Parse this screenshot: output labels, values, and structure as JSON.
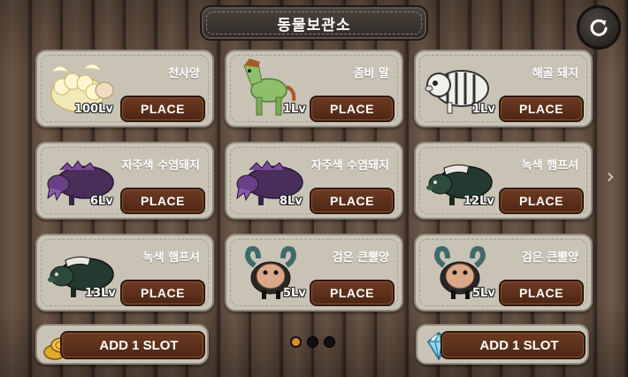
{
  "header": {
    "title": "동물보관소"
  },
  "icons": {
    "refresh": "refresh-icon",
    "next": "chevron-right-icon"
  },
  "cards": [
    {
      "name": "천사양",
      "level": "100Lv",
      "button": "PLACE",
      "animal": "angel-sheep-icon"
    },
    {
      "name": "좀비 말",
      "level": "1Lv",
      "button": "PLACE",
      "animal": "zombie-horse-icon"
    },
    {
      "name": "해골 돼지",
      "level": "1Lv",
      "button": "PLACE",
      "animal": "skeleton-pig-icon"
    },
    {
      "name": "자주색 수염돼지",
      "level": "6Lv",
      "button": "PLACE",
      "animal": "purple-bearded-pig-icon"
    },
    {
      "name": "자주색 수염돼지",
      "level": "8Lv",
      "button": "PLACE",
      "animal": "purple-bearded-pig-icon"
    },
    {
      "name": "녹색 햄프셔",
      "level": "12Lv",
      "button": "PLACE",
      "animal": "green-hampshire-icon"
    },
    {
      "name": "녹색 햄프셔",
      "level": "13Lv",
      "button": "PLACE",
      "animal": "green-hampshire-icon"
    },
    {
      "name": "검은 큰뿔양",
      "level": "5Lv",
      "button": "PLACE",
      "animal": "black-bighorn-sheep-icon"
    },
    {
      "name": "검은 큰뿔양",
      "level": "5Lv",
      "button": "PLACE",
      "animal": "black-bighorn-sheep-icon"
    }
  ],
  "footer": {
    "left_slot": {
      "label": "ADD 1 SLOT",
      "icon": "gold-coins-icon"
    },
    "right_slot": {
      "label": "ADD 1 SLOT",
      "icon": "crystal-gem-icon"
    },
    "pager": {
      "pages": 3,
      "current": 1
    }
  },
  "colors": {
    "accent": "#e08a2a",
    "button": "#5a2e18",
    "card": "#c9c3b6"
  }
}
